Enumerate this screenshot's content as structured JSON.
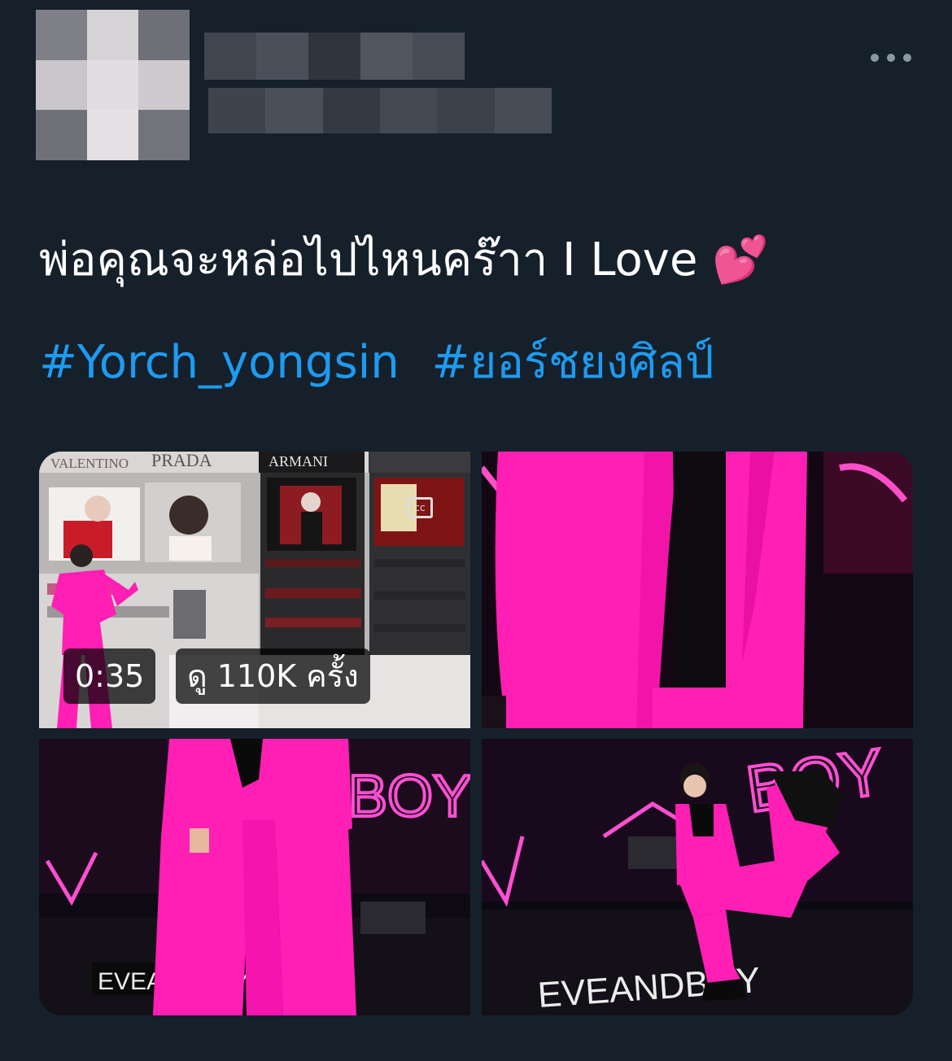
{
  "tweet": {
    "text": "พ่อคุณจะหล่อไปไหนคร๊าา I Love 💕",
    "hashtags": [
      "#Yorch_yongsin",
      "#ยอร์ชยงศิลป์"
    ]
  },
  "video": {
    "duration": "0:35",
    "views": "ดู 110K ครั้ง",
    "cc_label": "cc"
  },
  "store_signs": [
    "VALENTINO",
    "PRADA",
    "ARMANI"
  ],
  "neon_signs": [
    "BOY",
    "EVEANDBOY",
    "EVEANDBOY"
  ],
  "icons": {
    "more": "more-horizontal-icon",
    "captions": "closed-captions-icon"
  },
  "colors": {
    "background": "#15202b",
    "text": "#ffffff",
    "link": "#1d9bf0",
    "muted": "#8899a6",
    "accent_pink": "#ff1fb4"
  }
}
